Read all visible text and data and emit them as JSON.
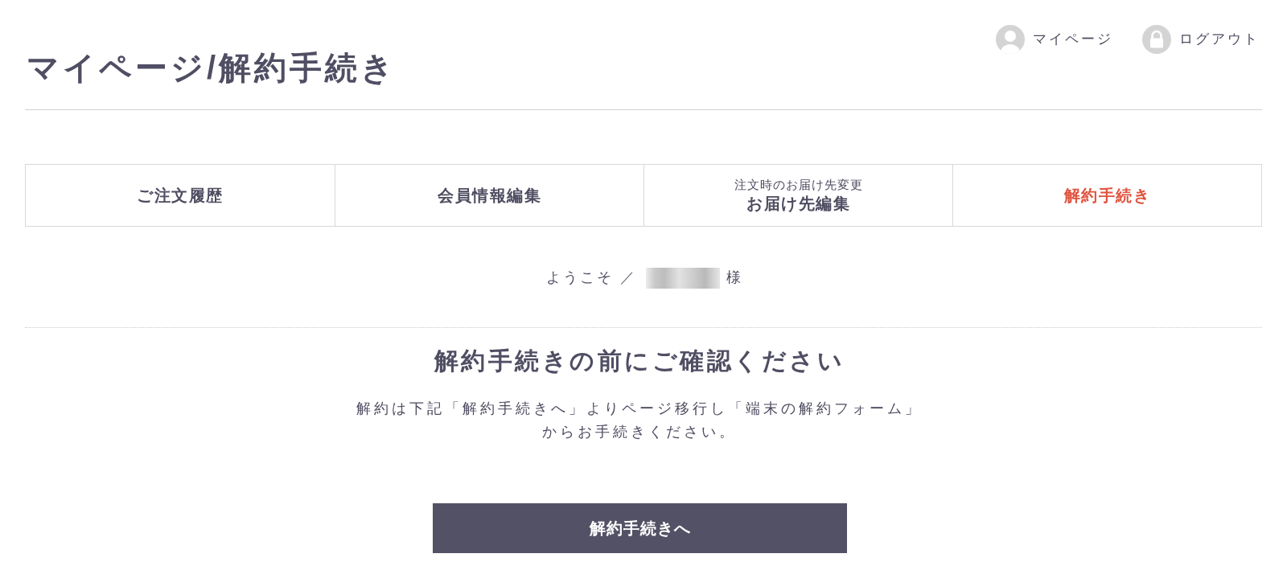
{
  "header": {
    "links": [
      {
        "label": "マイページ"
      },
      {
        "label": "ログアウト"
      }
    ]
  },
  "page_title": "マイページ/解約手続き",
  "tabs": [
    {
      "label": "ご注文履歴",
      "selected": false
    },
    {
      "label": "会員情報編集",
      "selected": false
    },
    {
      "caption": "注文時のお届け先変更",
      "label": "お届け先編集",
      "selected": false
    },
    {
      "label": "解約手続き",
      "selected": true
    }
  ],
  "welcome": {
    "greeting": "ようこそ ／",
    "honorific": "様"
  },
  "notice": {
    "heading": "解約手続きの前にご確認ください",
    "body": "解約は下記「解約手続きへ」よりページ移行し「端末の解約フォーム」からお手続きください。"
  },
  "button": {
    "label": "解約手続きへ"
  }
}
